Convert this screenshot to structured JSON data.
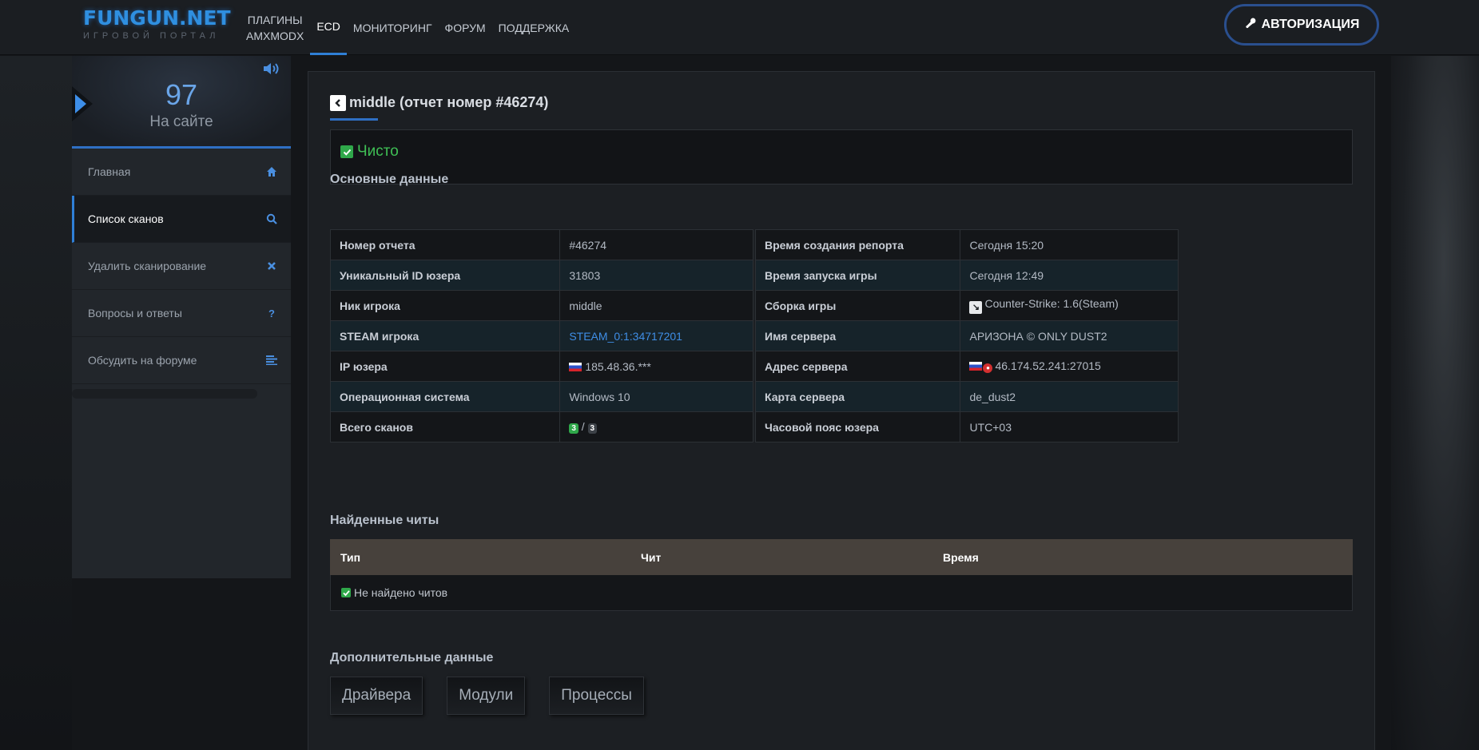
{
  "header": {
    "logo_title": "FUNGUN.NET",
    "logo_subtitle": "ИГРОВОЙ ПОРТАЛ",
    "nav": [
      {
        "line1": "ПЛАГИНЫ",
        "line2": "AMXMODX"
      },
      {
        "label": "ECD"
      },
      {
        "label": "МОНИТОРИНГ"
      },
      {
        "label": "ФОРУМ"
      },
      {
        "label": "ПОДДЕРЖКА"
      }
    ],
    "auth_label": "АВТОРИЗАЦИЯ",
    "accent": "#2f7fd6"
  },
  "sidebar": {
    "online_count": "97",
    "online_label": "На сайте",
    "items": [
      {
        "label": "Главная",
        "icon": "home-icon"
      },
      {
        "label": "Список сканов",
        "icon": "search-icon"
      },
      {
        "label": "Удалить сканирование",
        "icon": "close-icon"
      },
      {
        "label": "Вопросы и ответы",
        "icon": "question-icon"
      },
      {
        "label": "Обсудить на форуме",
        "icon": "list-icon"
      }
    ]
  },
  "report": {
    "title": "middle (отчет номер #46274)",
    "status": "Чисто",
    "status_color": "#3fbf55",
    "section_main": "Основные данные",
    "left": [
      {
        "key": "Номер отчета",
        "value": "#46274"
      },
      {
        "key": "Уникальный ID юзера",
        "value": "31803"
      },
      {
        "key": "Ник игрока",
        "value": "middle"
      },
      {
        "key": "STEAM игрока",
        "value": "STEAM_0:1:34717201"
      },
      {
        "key": "IP юзера",
        "value": "185.48.36.***"
      },
      {
        "key": "Операционная система",
        "value": "Windows 10"
      },
      {
        "key": "Всего сканов",
        "value_a": "3",
        "separator": "/",
        "value_b": "3"
      }
    ],
    "right": [
      {
        "key": "Время создания репорта",
        "value": "Сегодня 15:20"
      },
      {
        "key": "Время запуска игры",
        "value": "Сегодня 12:49"
      },
      {
        "key": "Сборка игры",
        "value": "Counter-Strike: 1.6(Steam)"
      },
      {
        "key": "Имя сервера",
        "value": "АРИЗОНА © ONLY DUST2"
      },
      {
        "key": "Адрес сервера",
        "value": "46.174.52.241:27015"
      },
      {
        "key": "Карта сервера",
        "value": "de_dust2"
      },
      {
        "key": "Часовой пояс юзера",
        "value": "UTC+03"
      }
    ],
    "section_cheats": "Найденные читы",
    "cheats_columns": [
      "Тип",
      "Чит",
      "Время"
    ],
    "cheats_empty": "Не найдено читов",
    "section_extra": "Дополнительные данные",
    "extra_buttons": [
      "Драйвера",
      "Модули",
      "Процессы"
    ]
  }
}
